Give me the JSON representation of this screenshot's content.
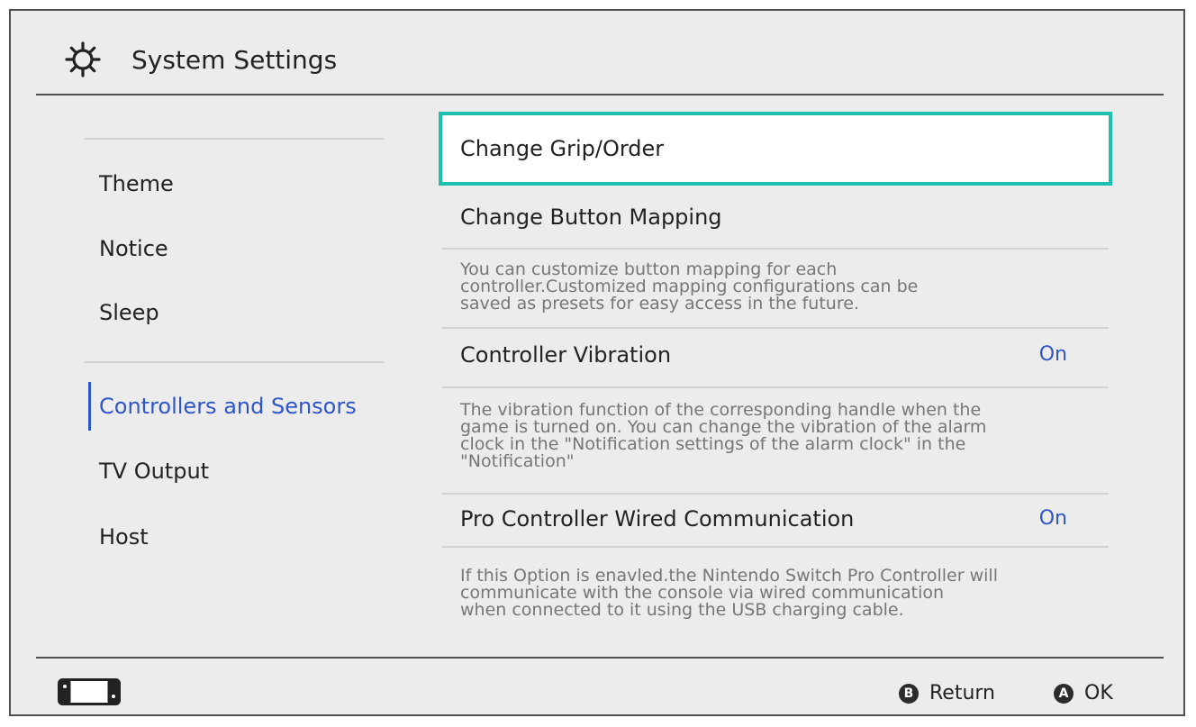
{
  "header": {
    "icon": "gear-icon",
    "title": "System Settings"
  },
  "sidebar": {
    "items": [
      {
        "label": "Theme"
      },
      {
        "label": "Notice"
      },
      {
        "label": "Sleep"
      },
      {
        "label": "Controllers and Sensors",
        "active": true
      },
      {
        "label": "TV Output"
      },
      {
        "label": "Host"
      }
    ]
  },
  "settings": [
    {
      "label": "Change Grip/Order",
      "selected": true
    },
    {
      "label": "Change Button Mapping"
    },
    {
      "description_lines": [
        "You can customize button mapping for each",
        "controller.Customized mapping configurations can be",
        "saved as presets for easy access in the future."
      ]
    },
    {
      "label": "Controller Vibration",
      "value": "On"
    },
    {
      "description_lines": [
        "The vibration function of the corresponding handle when the",
        "game is turned on. You can change the vibration of the alarm",
        "clock in the \"Notification settings of the alarm clock\" in the",
        "\"Notification\""
      ]
    },
    {
      "label": "Pro Controller Wired Communication",
      "value": "On"
    },
    {
      "description_lines": [
        "If this Option is enavled.the Nintendo Switch Pro Controller will",
        "communicate with the console via wired communication",
        "when connected to it using the USB charging cable."
      ]
    }
  ],
  "footer": {
    "device_icon": "console-icon",
    "buttons": [
      {
        "key": "B",
        "label": "Return"
      },
      {
        "key": "A",
        "label": "OK"
      }
    ]
  },
  "colors": {
    "accent": "#2f56c8",
    "selection_border": "#1fbfae",
    "background": "#ececec"
  }
}
